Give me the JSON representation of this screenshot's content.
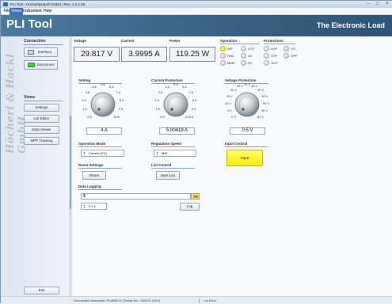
{
  "window": {
    "title": "PLI Tool - Höcherl&Hackl GmbH | Rev. 1.2.1.93"
  },
  "menu": [
    "File",
    "Views",
    "Instrument",
    "Help"
  ],
  "header": {
    "title": "PLI Tool",
    "brand": "The Electronic Load"
  },
  "sidebar": {
    "brand_text": "Höcherl & Hackl GmbH",
    "connection_title": "Connection",
    "interface_label": "Interface",
    "disconnect_label": "Disconnect",
    "views_title": "Views",
    "views": [
      "Settings",
      "List Editor",
      "Data Viewer",
      "MPP Tracking"
    ],
    "exit_label": "Exit"
  },
  "measure": {
    "voltage": {
      "label": "Voltage",
      "value": "29.817 V"
    },
    "current": {
      "label": "Current",
      "value": "3.9995 A"
    },
    "power": {
      "label": "Power",
      "value": "119.25 W"
    }
  },
  "operation": {
    "title": "Operation",
    "items": [
      {
        "name": "INP",
        "on": true
      },
      {
        "name": "LIST",
        "on": false
      },
      {
        "name": "RSD",
        "on": false
      },
      {
        "name": "UV",
        "on": false
      },
      {
        "name": "MEM",
        "on": false
      },
      {
        "name": "RV",
        "on": false
      }
    ]
  },
  "protections": {
    "title": "Protections",
    "items": [
      {
        "name": "UVP",
        "on": false
      },
      {
        "name": "OV",
        "on": false
      },
      {
        "name": "OTP",
        "on": false
      },
      {
        "name": "OPP",
        "on": false
      },
      {
        "name": "OCP",
        "on": false
      }
    ]
  },
  "setting": {
    "title": "Setting",
    "scale": [
      "0 A",
      "1 A",
      "2 A",
      "3 A",
      "4 A",
      "5 A",
      "6 A",
      "7 A",
      "8 A",
      "9 A",
      "10 A"
    ],
    "value": "4 A"
  },
  "current_protection": {
    "title": "Current Protection",
    "scale": [
      "0 A",
      "1 A",
      "2 A",
      "3 A",
      "4 A",
      "5 A",
      "6 A",
      "7 A",
      "8 A",
      "9 A",
      "10.5 A"
    ],
    "value": "5.00419 A"
  },
  "voltage_protection": {
    "title": "Voltage Protection",
    "scale": [
      "0 V",
      "5 V",
      "10 V",
      "15 V",
      "20 V",
      "25 V",
      "30 V",
      "35 V",
      "40 V",
      "45 V",
      "50 V",
      "55 V",
      "63 V"
    ],
    "value": "0.5 V"
  },
  "operation_mode": {
    "title": "Operation Mode",
    "value": "Current (CC)"
  },
  "regulation_speed": {
    "title": "Regulation Speed",
    "value": "MID"
  },
  "input_control": {
    "title": "Input Control",
    "button": "Input"
  },
  "reset_settings": {
    "title": "Reset Settings",
    "button": "Reset"
  },
  "list_control": {
    "title": "List Control",
    "button": "Start List"
  },
  "data_logging": {
    "title": "Data Logging",
    "path": "$",
    "interval": "0.1 s",
    "button": "Log"
  },
  "status": {
    "instrument": "Connected Instrument: PLI806C10 (Serial-No.: 106274-1014)",
    "error": "- no Error -"
  },
  "colors": {
    "header": "#4a7ba0",
    "led_on": "#f0e000",
    "input_button": "#ffff33",
    "connect": "#44cc44"
  }
}
